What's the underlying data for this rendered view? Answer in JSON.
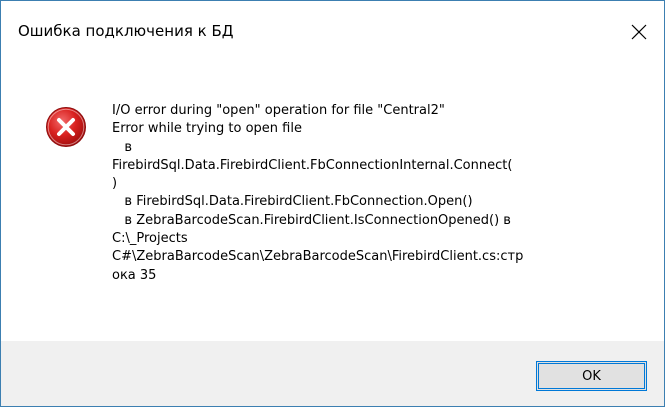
{
  "dialog": {
    "title": "Ошибка подключения к БД",
    "icon": "error-icon",
    "message_lines": [
      "I/O error during \"open\" operation for file \"Central2\"",
      "Error while trying to open file",
      "   в",
      "FirebirdSql.Data.FirebirdClient.FbConnectionInternal.Connect(",
      ")",
      "   в FirebirdSql.Data.FirebirdClient.FbConnection.Open()",
      "   в ZebraBarcodeScan.FirebirdClient.IsConnectionOpened() в",
      "C:\\_Projects",
      "C#\\ZebraBarcodeScan\\ZebraBarcodeScan\\FirebirdClient.cs:стр",
      "ока 35"
    ],
    "ok_label": "OK"
  },
  "colors": {
    "window_border": "#3c7fb1",
    "footer_bg": "#f0f0f0",
    "button_border": "#0078d7",
    "error_red": "#e81123"
  }
}
